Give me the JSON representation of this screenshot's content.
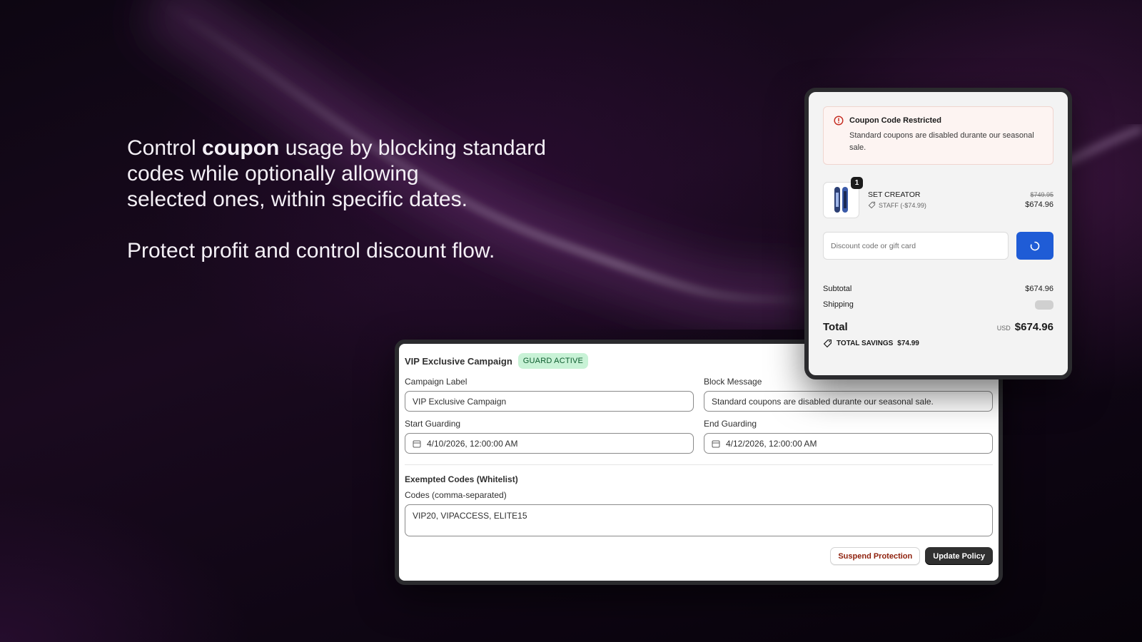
{
  "hero": {
    "line1_before": "Control ",
    "line1_bold": "coupon",
    "line1_after": " usage by blocking standard",
    "line2": "codes while optionally allowing",
    "line3": "selected ones, within specific dates.",
    "tagline": "Protect profit and control discount flow."
  },
  "admin": {
    "title": "VIP Exclusive Campaign",
    "status_badge": "GUARD ACTIVE",
    "campaign_label": {
      "label": "Campaign Label",
      "value": "VIP Exclusive Campaign"
    },
    "block_message": {
      "label": "Block Message",
      "value": "Standard coupons are disabled durante our seasonal sale."
    },
    "start_guarding": {
      "label": "Start Guarding",
      "value": "4/10/2026, 12:00:00 AM",
      "icon": "calendar-icon"
    },
    "end_guarding": {
      "label": "End Guarding",
      "value": "4/12/2026, 12:00:00 AM",
      "icon": "calendar-icon"
    },
    "whitelist": {
      "section_title": "Exempted Codes (Whitelist)",
      "label": "Codes (comma-separated)",
      "value": "VIP20, VIPACCESS, ELITE15"
    },
    "actions": {
      "suspend_label": "Suspend Protection",
      "update_label": "Update Policy"
    }
  },
  "checkout": {
    "alert": {
      "title": "Coupon Code Restricted",
      "message": "Standard coupons are disabled durante our seasonal sale.",
      "icon": "alert-circle-icon"
    },
    "item": {
      "quantity": "1",
      "name": "SET CREATOR",
      "discount_tag": "STAFF (-$74.99)",
      "price_original": "$749.95",
      "price_current": "$674.96"
    },
    "discount": {
      "placeholder": "Discount code or gift card",
      "apply_icon": "spinner-icon"
    },
    "summary": {
      "subtotal_label": "Subtotal",
      "subtotal_value": "$674.96",
      "shipping_label": "Shipping",
      "total_label": "Total",
      "currency": "USD",
      "total_value": "$674.96",
      "savings_label": "TOTAL SAVINGS",
      "savings_value": "$74.99"
    }
  },
  "colors": {
    "accent_blue": "#1f5cd6",
    "badge_green_bg": "#c8f2d6",
    "danger_text": "#8e1f0b",
    "alert_red": "#c4281c"
  }
}
